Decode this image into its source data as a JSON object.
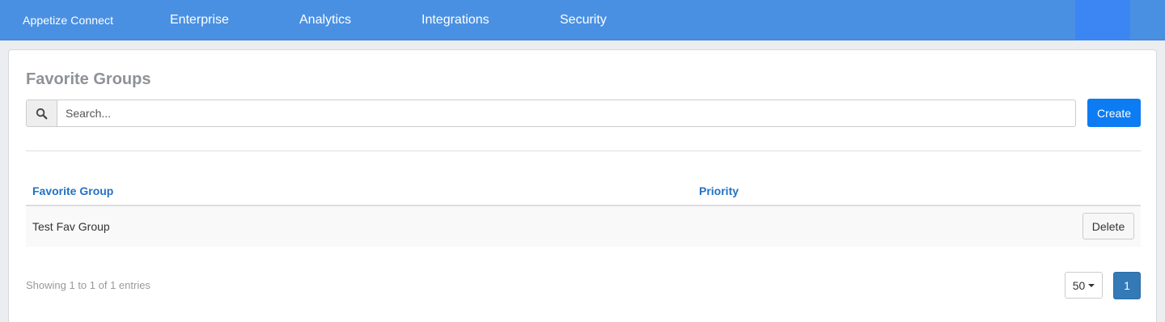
{
  "nav": {
    "brand": "Appetize Connect",
    "items": [
      {
        "label": "Enterprise"
      },
      {
        "label": "Analytics"
      },
      {
        "label": "Integrations"
      },
      {
        "label": "Security"
      }
    ]
  },
  "page": {
    "title": "Favorite Groups",
    "search_placeholder": "Search...",
    "search_icon": "search-icon",
    "create_label": "Create"
  },
  "table": {
    "columns": [
      "Favorite Group",
      "Priority"
    ],
    "rows": [
      {
        "name": "Test Fav Group",
        "priority": "",
        "action": "Delete"
      }
    ]
  },
  "footer": {
    "showing": "Showing 1 to 1 of 1 entries",
    "page_size": "50",
    "current_page": "1"
  },
  "colors": {
    "nav_bg": "#4a90e2",
    "primary": "#0d7cf2",
    "link": "#2272c3",
    "pagination_active": "#337ab7"
  }
}
